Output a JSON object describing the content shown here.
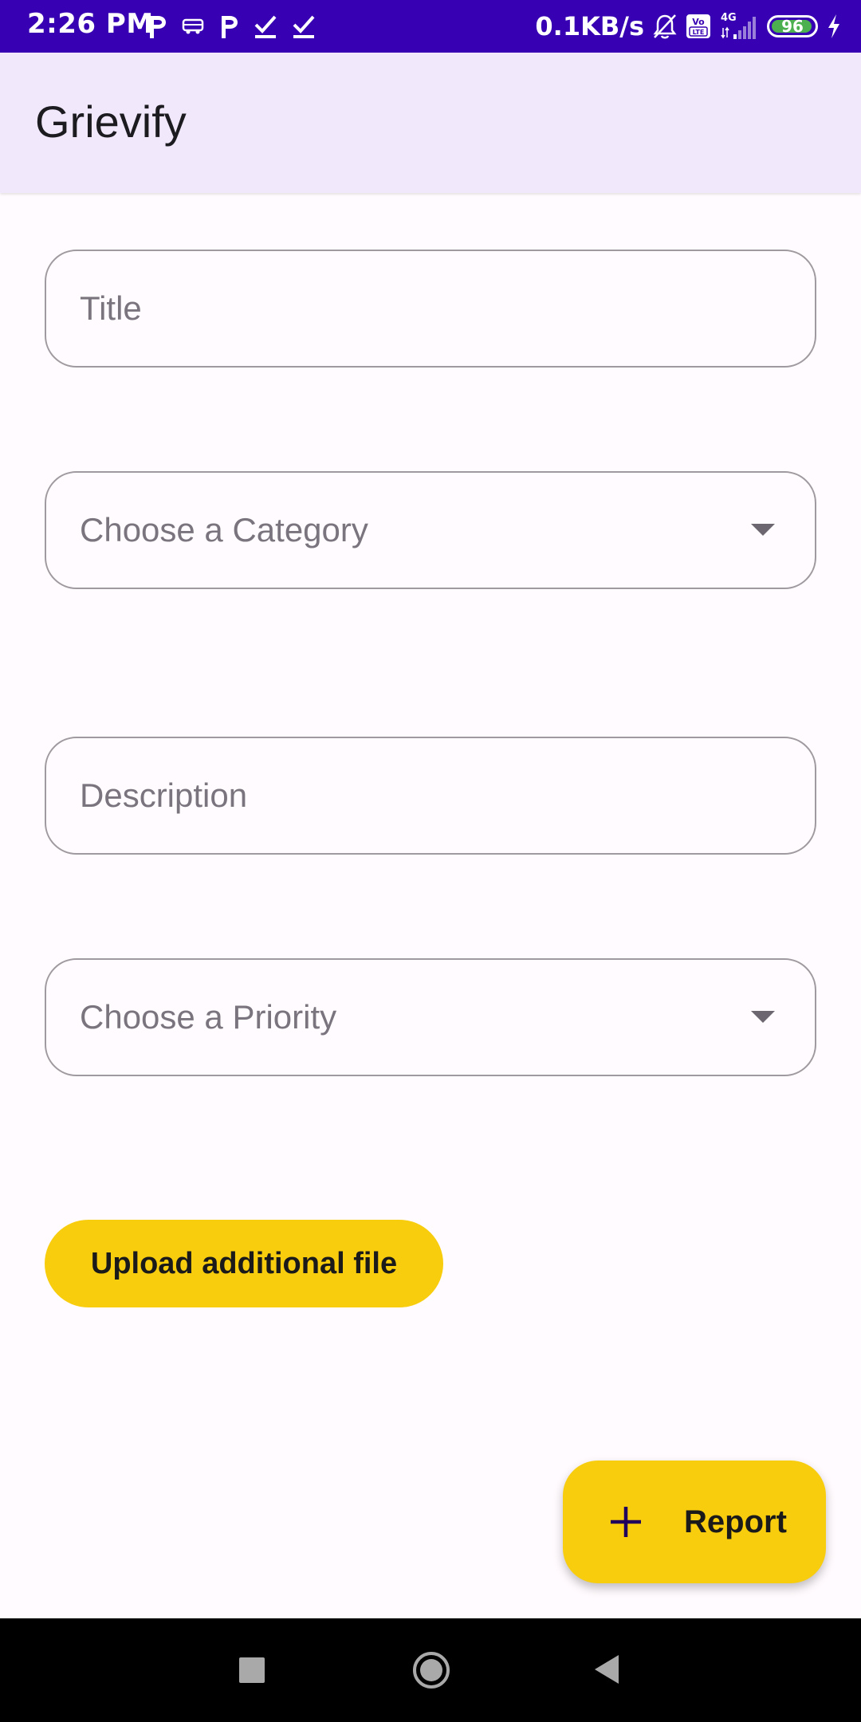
{
  "status_bar": {
    "time": "2:26 PM",
    "net_speed": "0.1KB/s",
    "network_type": "4G",
    "volte": "Vo LTE",
    "battery_level": "96",
    "battery_fraction": 0.96,
    "left_icons": [
      "p-app-icon",
      "bus-icon",
      "p-app-icon",
      "checkmark-icon",
      "checkmark-icon"
    ],
    "right_icons": [
      "bell-off-icon",
      "volte-icon",
      "signal-icon",
      "battery-icon",
      "charging-icon"
    ]
  },
  "app_bar": {
    "title": "Grievify"
  },
  "form": {
    "title_placeholder": "Title",
    "category_placeholder": "Choose a Category",
    "description_placeholder": "Description",
    "priority_placeholder": "Choose a Priority",
    "upload_label": "Upload additional file"
  },
  "fab": {
    "label": "Report",
    "icon": "plus-icon"
  },
  "nav_bar": {
    "buttons": [
      "recents-icon",
      "home-icon",
      "back-icon"
    ]
  },
  "colors": {
    "status_bar": "#3700b3",
    "app_bar": "#f1e8fc",
    "accent_yellow": "#f8cd0d",
    "background": "#fffbfe",
    "outline": "#9e9a9f",
    "placeholder": "#79747e"
  }
}
